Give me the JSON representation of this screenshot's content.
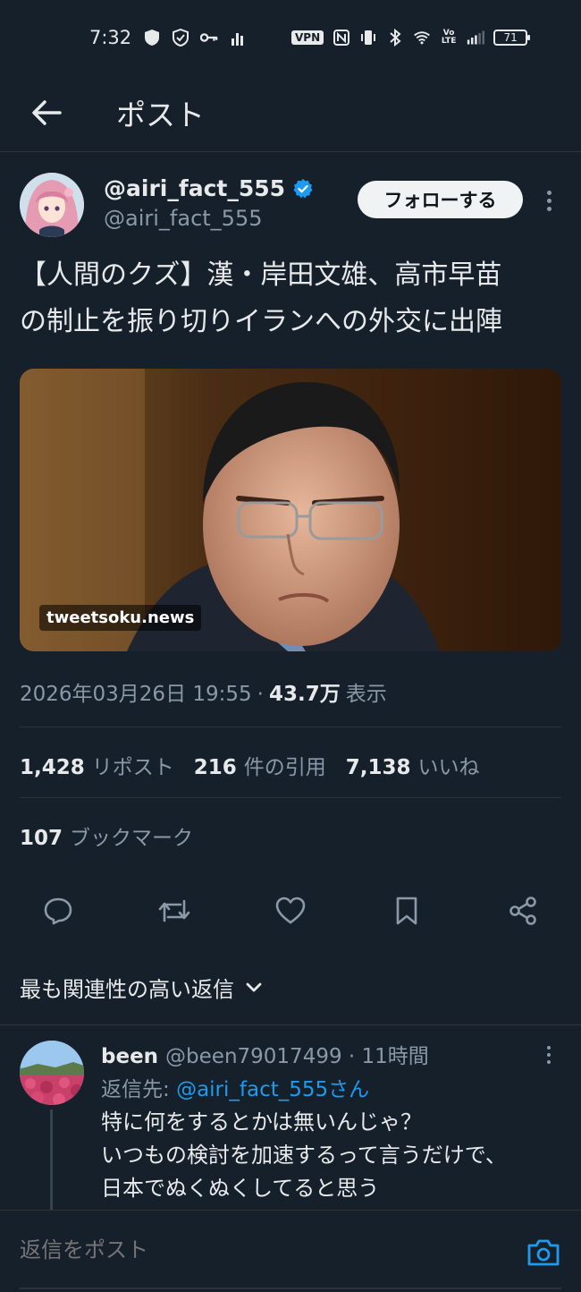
{
  "status_bar": {
    "time": "7:32",
    "vpn": "VPN",
    "battery": "71"
  },
  "header": {
    "title": "ポスト"
  },
  "post": {
    "author_name": "@airi_fact_555",
    "author_handle": "@airi_fact_555",
    "follow_label": "フォローする",
    "text_line1": "【人間のクズ】漢・岸田文雄、高市早苗",
    "text_line2": "の制止を振り切りイランへの外交に出陣",
    "media_source": "tweetsoku.news",
    "date": "2026年03月26日 19:55",
    "separator": "·",
    "views": "43.7万",
    "views_label": "表示"
  },
  "stats": {
    "reposts": "1,428",
    "reposts_label": "リポスト",
    "quotes": "216",
    "quotes_label": "件の引用",
    "likes": "7,138",
    "likes_label": "いいね",
    "bookmarks": "107",
    "bookmarks_label": "ブックマーク"
  },
  "sort": {
    "label": "最も関連性の高い返信"
  },
  "reply": {
    "name": "been",
    "meta": "@been79017499 · 11時間",
    "reply_to_prefix": "返信先: ",
    "reply_to_mention": "@airi_fact_555さん",
    "line1": "特に何をするとかは無いんじゃ？",
    "line2": "いつもの検討を加速するって言うだけで、",
    "line3": "日本でぬくぬくしてると思う"
  },
  "compose": {
    "placeholder": "返信をポスト"
  },
  "colors": {
    "background": "#15202b",
    "accent": "#1d9bf0",
    "secondary_text": "#8b98a5"
  }
}
